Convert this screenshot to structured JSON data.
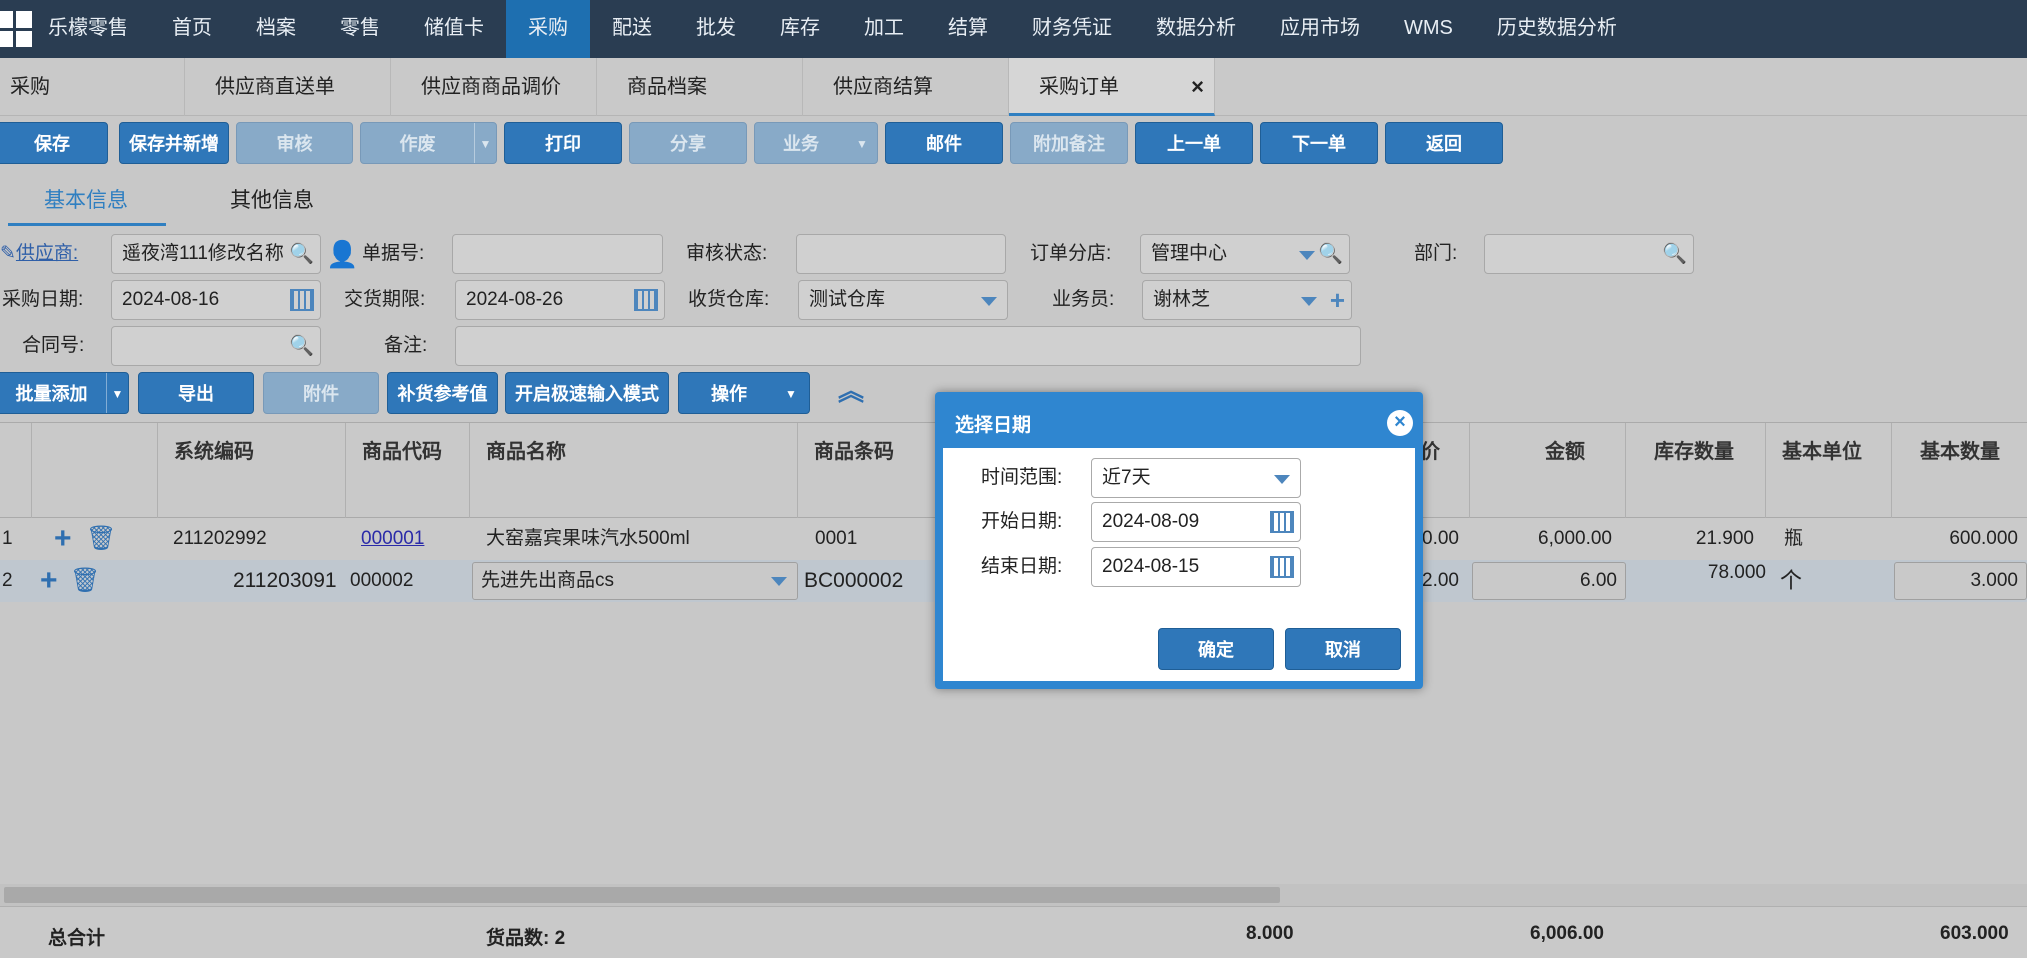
{
  "nav": {
    "brand": "乐檬零售",
    "items": [
      "首页",
      "档案",
      "零售",
      "储值卡",
      "采购",
      "配送",
      "批发",
      "库存",
      "加工",
      "结算",
      "财务凭证",
      "数据分析",
      "应用市场",
      "WMS",
      "历史数据分析"
    ],
    "active": "采购"
  },
  "page_tabs": [
    "采购",
    "供应商直送单",
    "供应商商品调价",
    "商品档案",
    "供应商结算",
    "采购订单"
  ],
  "toolbar": {
    "save": "保存",
    "save_new": "保存并新增",
    "audit": "审核",
    "void": "作废",
    "print": "打印",
    "share": "分享",
    "business": "业务",
    "mail": "邮件",
    "remark": "附加备注",
    "prev": "上一单",
    "next": "下一单",
    "back": "返回"
  },
  "form_tabs": [
    "基本信息",
    "其他信息"
  ],
  "form": {
    "supplier_label": "供应商:",
    "supplier_value": "遥夜湾111修改名称",
    "doc_no_label": "单据号:",
    "doc_no_value": "",
    "audit_status_label": "审核状态:",
    "audit_status_value": "",
    "branch_label": "订单分店:",
    "branch_value": "管理中心",
    "dept_label": "部门:",
    "dept_value": "",
    "purchase_date_label": "采购日期:",
    "purchase_date_value": "2024-08-16",
    "delivery_label": "交货期限:",
    "delivery_value": "2024-08-26",
    "warehouse_label": "收货仓库:",
    "warehouse_value": "测试仓库",
    "salesman_label": "业务员:",
    "salesman_value": "谢林芝",
    "contract_label": "合同号:",
    "contract_value": "",
    "memo_label": "备注:",
    "memo_value": ""
  },
  "grid_toolbar": {
    "batch_add": "批量添加",
    "export": "导出",
    "attach": "附件",
    "refill": "补货参考值",
    "fast_mode": "开启极速输入模式",
    "operate": "操作"
  },
  "table": {
    "headers": [
      "系统编码",
      "商品代码",
      "商品名称",
      "商品条码",
      "价",
      "金额",
      "库存数量",
      "基本单位",
      "基本数量"
    ],
    "rows": [
      {
        "idx": "1",
        "sys": "211202992",
        "code": "000001",
        "name": "大窑嘉宾果味汽水500ml",
        "barcode": "0001",
        "price": "0.00",
        "amount": "6,000.00",
        "stock": "21.900",
        "unit": "瓶",
        "qty": "600.000"
      },
      {
        "idx": "2",
        "sys": "211203091",
        "code": "000002",
        "name": "先进先出商品cs",
        "barcode": "BC000002",
        "price": "2.00",
        "amount": "6.00",
        "stock": "78.000",
        "unit": "个",
        "qty": "3.000"
      }
    ]
  },
  "footer": {
    "total_label": "总合计",
    "count_label": "货品数: 2",
    "sum1": "8.000",
    "sum2": "6,006.00",
    "sum3": "603.000"
  },
  "modal": {
    "title": "选择日期",
    "range_label": "时间范围:",
    "range_value": "近7天",
    "start_label": "开始日期:",
    "start_value": "2024-08-09",
    "end_label": "结束日期:",
    "end_value": "2024-08-15",
    "ok": "确定",
    "cancel": "取消"
  }
}
